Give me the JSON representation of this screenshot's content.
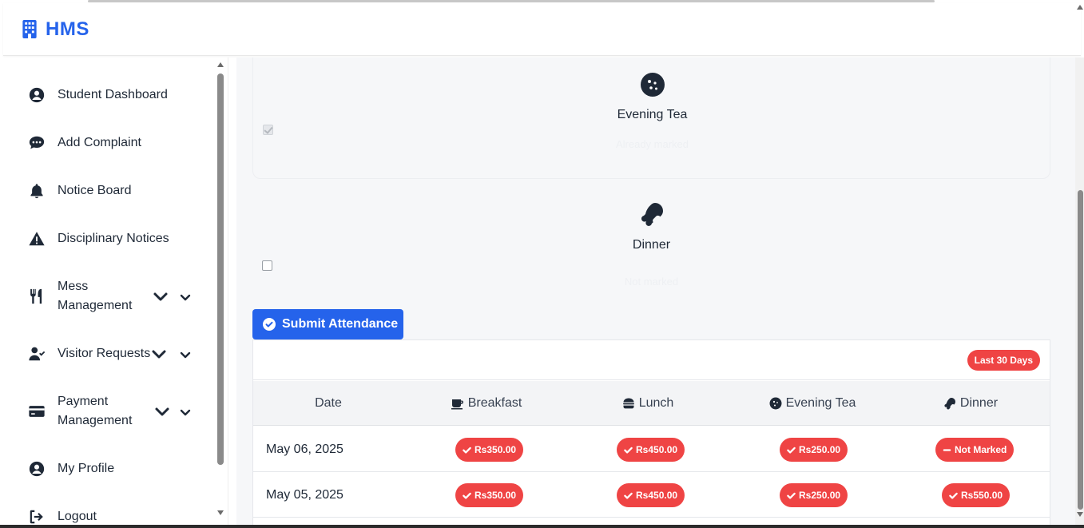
{
  "app": {
    "brand": "HMS",
    "brand_color": "#2563eb",
    "accent_red": "#ef4444"
  },
  "sidebar": {
    "items": [
      {
        "label": "Student Dashboard",
        "icon": "user-circle-icon"
      },
      {
        "label": "Add Complaint",
        "icon": "comment-dots-icon"
      },
      {
        "label": "Notice Board",
        "icon": "bell-icon"
      },
      {
        "label": "Disciplinary Notices",
        "icon": "warning-triangle-icon"
      },
      {
        "label": "Mess Management",
        "icon": "utensils-icon",
        "expandable": true
      },
      {
        "label": "Visitor Requests",
        "icon": "user-check-icon",
        "expandable": true
      },
      {
        "label": "Payment Management",
        "icon": "credit-card-icon",
        "expandable": true
      },
      {
        "label": "My Profile",
        "icon": "user-circle-icon"
      },
      {
        "label": "Logout",
        "icon": "logout-icon"
      }
    ]
  },
  "attendance": {
    "meals": [
      {
        "name": "Evening Tea",
        "icon": "cookie-icon",
        "checked": true,
        "disabled": true,
        "status": "Already marked"
      },
      {
        "name": "Dinner",
        "icon": "drumstick-icon",
        "checked": false,
        "disabled": false,
        "status": "Not marked"
      }
    ],
    "submit_label": "Submit Attendance"
  },
  "history": {
    "range_badge": "Last 30 Days",
    "columns": [
      {
        "label": "Date",
        "icon": ""
      },
      {
        "label": "Breakfast",
        "icon": "mug-icon"
      },
      {
        "label": "Lunch",
        "icon": "burger-icon"
      },
      {
        "label": "Evening Tea",
        "icon": "cookie-icon"
      },
      {
        "label": "Dinner",
        "icon": "drumstick-icon"
      }
    ],
    "rows": [
      {
        "date": "May 06, 2025",
        "breakfast": "Rs350.00",
        "lunch": "Rs450.00",
        "evening_tea": "Rs250.00",
        "dinner": "Not Marked",
        "dinner_status": "not-marked"
      },
      {
        "date": "May 05, 2025",
        "breakfast": "Rs350.00",
        "lunch": "Rs450.00",
        "evening_tea": "Rs250.00",
        "dinner": "Rs550.00",
        "dinner_status": "marked"
      }
    ]
  }
}
